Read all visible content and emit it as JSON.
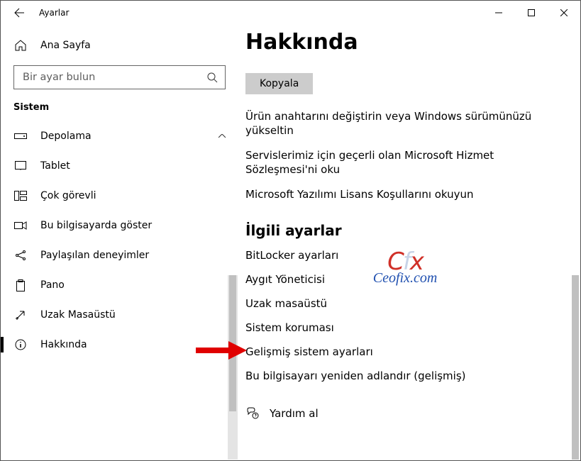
{
  "window": {
    "title": "Ayarlar"
  },
  "sidebar": {
    "home_label": "Ana Sayfa",
    "search_placeholder": "Bir ayar bulun",
    "category": "Sistem",
    "items": [
      {
        "label": "Depolama",
        "expandable": true
      },
      {
        "label": "Tablet"
      },
      {
        "label": "Çok görevli"
      },
      {
        "label": "Bu bilgisayarda göster"
      },
      {
        "label": "Paylaşılan deneyimler"
      },
      {
        "label": "Pano"
      },
      {
        "label": "Uzak Masaüstü"
      },
      {
        "label": "Hakkında",
        "selected": true
      }
    ]
  },
  "main": {
    "title": "Hakkında",
    "copy_button": "Kopyala",
    "links": [
      "Ürün anahtarını değiştirin veya Windows sürümünüzü yükseltin",
      "Servislerimiz için geçerli olan Microsoft Hizmet Sözleşmesi'ni oku",
      "Microsoft Yazılımı Lisans Koşullarını okuyun"
    ],
    "related_heading": "İlgili ayarlar",
    "related": [
      "BitLocker ayarları",
      "Aygıt Yöneticisi",
      "Uzak masaüstü",
      "Sistem koruması",
      "Gelişmiş sistem ayarları",
      "Bu bilgisayarı yeniden adlandır (gelişmiş)"
    ],
    "help_label": "Yardım al"
  },
  "watermark": {
    "line1_a": "C",
    "line1_b": "f",
    "line1_c": "x",
    "line2": "Ceofix.com"
  }
}
